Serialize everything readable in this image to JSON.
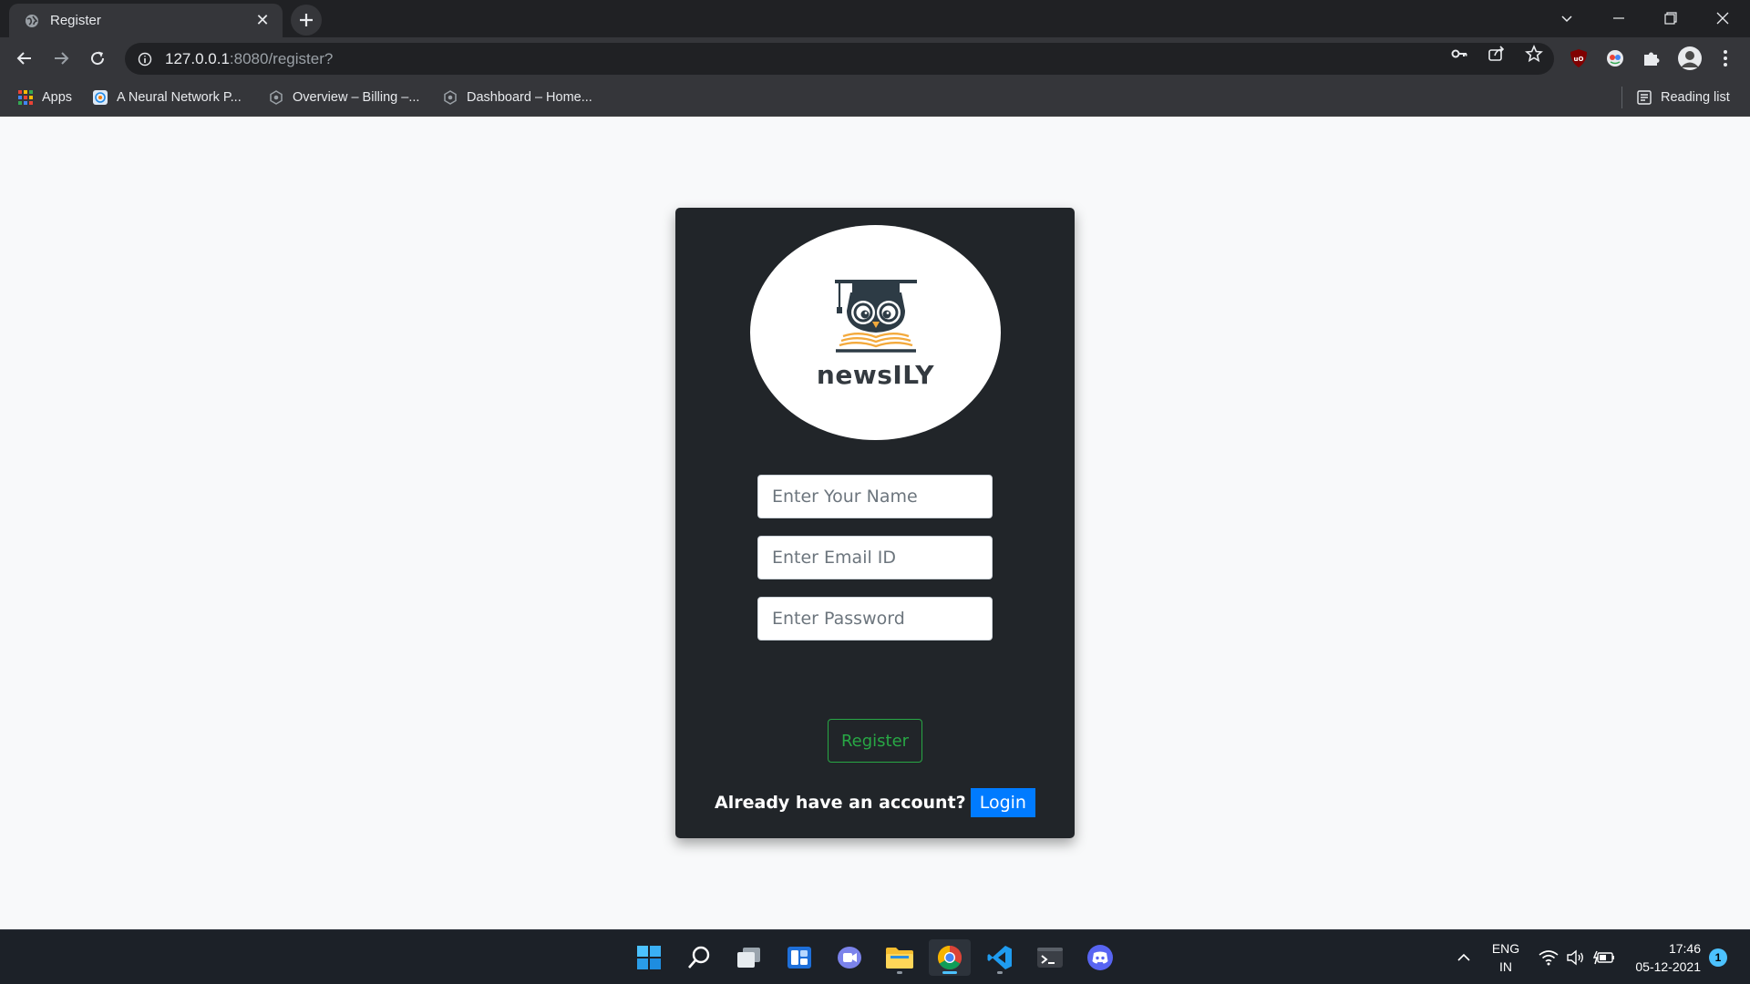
{
  "browser": {
    "tab_title": "Register",
    "url_host": "127.0.0.1",
    "url_rest": ":8080/register?",
    "bookmarks": [
      {
        "label": "Apps",
        "icon": "apps-grid-icon"
      },
      {
        "label": "A Neural Network P...",
        "icon": "tensorflow-playground-icon"
      },
      {
        "label": "Overview – Billing –...",
        "icon": "cloud-console-icon"
      },
      {
        "label": "Dashboard – Home...",
        "icon": "cloud-console-icon"
      }
    ],
    "reading_list": "Reading list"
  },
  "page": {
    "logo_text": "newsILY",
    "title": "Register",
    "name_placeholder": "Enter Your Name",
    "email_placeholder": "Enter Email ID",
    "password_placeholder": "Enter Password",
    "register_button": "Register",
    "account_prompt": "Already have an account?",
    "login_button": "Login"
  },
  "colors": {
    "card_bg": "#212529",
    "page_bg": "#f8f9fa",
    "success": "#28a745",
    "primary": "#007bff"
  },
  "taskbar": {
    "apps": [
      "start-icon",
      "search-icon",
      "task-view-icon",
      "widgets-icon",
      "teams-chat-icon",
      "file-explorer-icon",
      "chrome-icon",
      "vscode-icon",
      "terminal-icon",
      "discord-icon"
    ],
    "lang_line1": "ENG",
    "lang_line2": "IN",
    "time": "17:46",
    "date": "05-12-2021",
    "notification_count": "1"
  }
}
